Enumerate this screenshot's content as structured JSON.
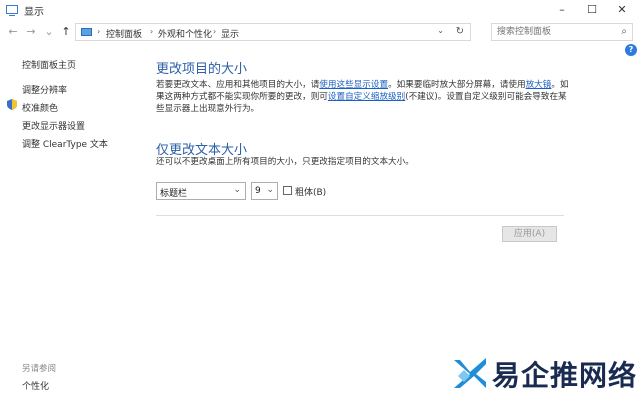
{
  "window": {
    "title": "显示",
    "minimize": "–",
    "maximize": "☐",
    "close": "✕"
  },
  "nav": {
    "back": "←",
    "forward": "→",
    "recent": "⌄",
    "up": "↑"
  },
  "address": {
    "crumbs": [
      "控制面板",
      "外观和个性化",
      "显示"
    ],
    "separator": "›",
    "dropdown": "⌄",
    "refresh": "↻"
  },
  "search": {
    "placeholder": "搜索控制面板",
    "icon": "⌕"
  },
  "help": "?",
  "sidebar": {
    "items": [
      "控制面板主页",
      "调整分辨率",
      "校准颜色",
      "更改显示器设置",
      "调整 ClearType 文本"
    ],
    "see_also_title": "另请参阅",
    "see_also": [
      "个性化"
    ]
  },
  "main": {
    "heading1": "更改项目的大小",
    "para1_a": "若要更改文本、应用和其他项目的大小，请",
    "para1_link1": "使用这些显示设置",
    "para1_b": "。如果要临时放大部分屏幕，请使用",
    "para1_link2": "放大镜",
    "para1_c": "。如",
    "para1_line2_a": "果这两种方式都不能实现你所要的更改，则可",
    "para1_link3": "设置自定义缩放级别",
    "para1_line2_b": "(不建议)。设置自定义级别可能会导致在某",
    "para1_line3": "些显示器上出现意外行为。",
    "heading2": "仅更改文本大小",
    "para2": "还可以不更改桌面上所有项目的大小，只更改指定项目的文本大小。",
    "item_select": "标题栏",
    "size_select": "9",
    "bold_label": "粗体(B)",
    "apply": "应用(A)"
  },
  "watermark": {
    "text": "易企推网络"
  },
  "colors": {
    "heading": "#2b5fa8",
    "link": "#1a5fc2",
    "accent": "#2d7be0"
  }
}
